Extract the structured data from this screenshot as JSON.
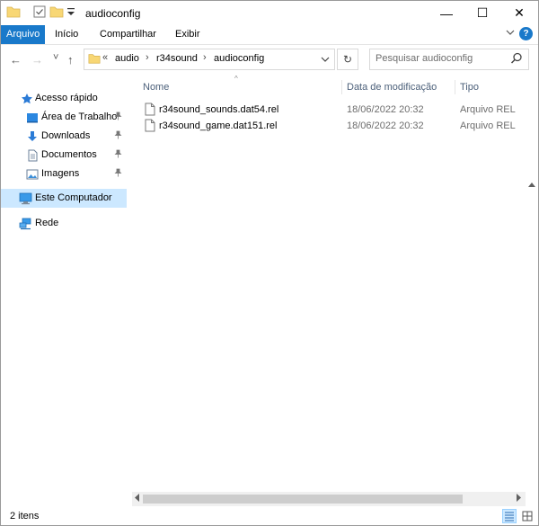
{
  "window": {
    "title": "audioconfig",
    "controls": {
      "minimize": "—",
      "maximize": "☐",
      "close": "✕"
    }
  },
  "ribbon": {
    "tabs": [
      {
        "label": "Arquivo",
        "active": true
      },
      {
        "label": "Início"
      },
      {
        "label": "Compartilhar"
      },
      {
        "label": "Exibir"
      }
    ],
    "help": "?"
  },
  "navbar": {
    "back": "←",
    "forward": "→",
    "recent": "˅",
    "up": "↑",
    "breadcrumb": {
      "overflow": "«",
      "segments": [
        "audio",
        "r34sound",
        "audioconfig"
      ],
      "separator": "›"
    },
    "dropdown": "˅",
    "refresh": "↻",
    "search_placeholder": "Pesquisar audioconfig"
  },
  "sidebar": {
    "items": [
      {
        "label": "Acesso rápido",
        "icon": "star-icon"
      },
      {
        "label": "Área de Trabalho",
        "icon": "desktop-icon",
        "pinned": true
      },
      {
        "label": "Downloads",
        "icon": "download-icon",
        "pinned": true
      },
      {
        "label": "Documentos",
        "icon": "document-icon",
        "pinned": true
      },
      {
        "label": "Imagens",
        "icon": "image-icon",
        "pinned": true
      },
      {
        "label": "Este Computador",
        "icon": "computer-icon",
        "selected": true
      },
      {
        "label": "Rede",
        "icon": "network-icon"
      }
    ],
    "pin_glyph": "📌"
  },
  "list": {
    "columns": {
      "name": "Nome",
      "date": "Data de modificação",
      "type": "Tipo"
    },
    "sort_indicator": "^",
    "files": [
      {
        "name": "r34sound_sounds.dat54.rel",
        "date": "18/06/2022 20:32",
        "type": "Arquivo REL"
      },
      {
        "name": "r34sound_game.dat151.rel",
        "date": "18/06/2022 20:32",
        "type": "Arquivo REL"
      }
    ]
  },
  "status": {
    "count": "2 itens"
  },
  "colors": {
    "accent": "#1979ca",
    "selection": "#cce8ff",
    "folder": "#f8d775"
  }
}
